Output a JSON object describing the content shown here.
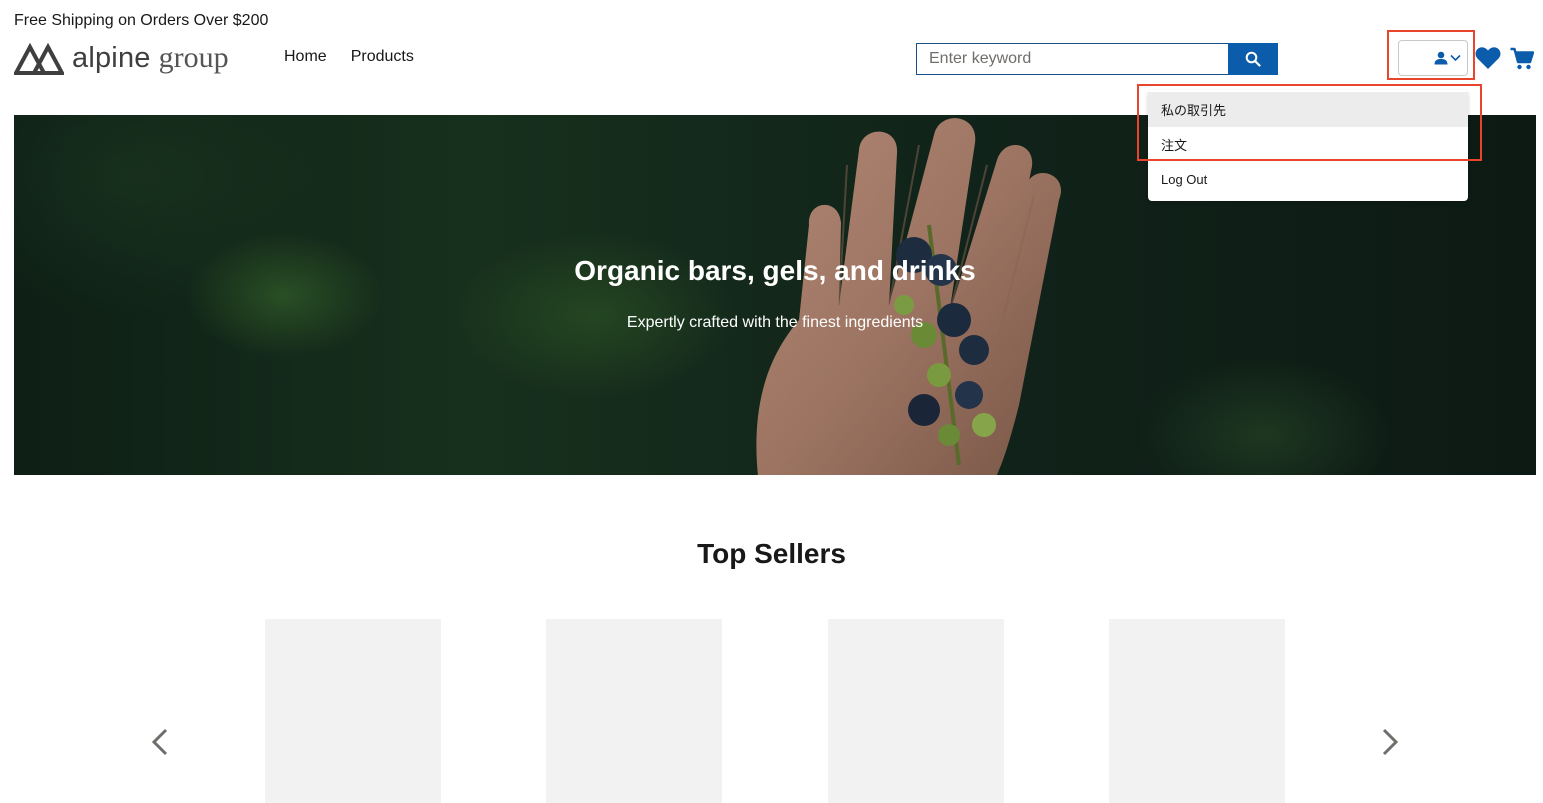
{
  "promo": "Free Shipping on Orders Over $200",
  "logo": {
    "word1": "alpine",
    "word2": "group"
  },
  "nav": {
    "home": "Home",
    "products": "Products"
  },
  "search": {
    "placeholder": "Enter keyword",
    "value": ""
  },
  "user_menu": {
    "items": [
      {
        "label": "私の取引先",
        "highlighted": true
      },
      {
        "label": "注文",
        "highlighted": false
      },
      {
        "label": "Log Out",
        "highlighted": false
      }
    ]
  },
  "icons": {
    "search": "search-icon",
    "user": "user-icon",
    "chevron": "chevron-down-icon",
    "wishlist": "heart-icon",
    "cart": "cart-icon",
    "prev": "chevron-left-icon",
    "next": "chevron-right-icon"
  },
  "hero": {
    "title": "Organic bars, gels, and drinks",
    "subtitle": "Expertly crafted with the finest ingredients"
  },
  "top_sellers": {
    "title": "Top Sellers",
    "product_count": 4
  },
  "colors": {
    "brand_blue": "#0b5cab",
    "annotation_red": "#e8452c",
    "card_placeholder": "#f2f2f2"
  }
}
